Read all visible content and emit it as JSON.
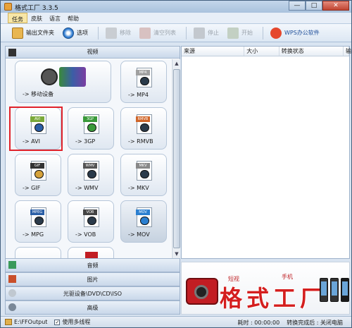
{
  "window": {
    "title": "格式工厂 3.3.5",
    "minimize": "—",
    "maximize": "□",
    "close": "✕"
  },
  "menu": [
    "任务",
    "皮肤",
    "语言",
    "帮助"
  ],
  "toolbar": {
    "output_folder": "输出文件夹",
    "options": "选项",
    "remove": "移除",
    "clear_list": "清空列表",
    "stop": "停止",
    "start": "开始",
    "wps": "WPS办公软件"
  },
  "video_header": "视频",
  "tiles": [
    {
      "label": "-> 移动设备",
      "tag": ""
    },
    {
      "label": "-> MP4",
      "tag": "MP4"
    },
    {
      "label": "-> AVI",
      "tag": "AVI"
    },
    {
      "label": "-> 3GP",
      "tag": "3GP"
    },
    {
      "label": "-> RMVB",
      "tag": "RMVB"
    },
    {
      "label": "-> GIF",
      "tag": "GIF"
    },
    {
      "label": "-> WMV",
      "tag": "WMV"
    },
    {
      "label": "-> MKV",
      "tag": "MKV"
    },
    {
      "label": "-> MPG",
      "tag": "MPEG"
    },
    {
      "label": "-> VOB",
      "tag": "VOB"
    },
    {
      "label": "-> MOV",
      "tag": "MOV"
    }
  ],
  "categories": [
    "音频",
    "图片",
    "光驱设备\\DVD\\CD\\ISO",
    "高级"
  ],
  "file_list": {
    "col_source": "来源",
    "col_size": "大小",
    "col_status": "转换状态",
    "col_out": "输"
  },
  "banner": {
    "brand": "格式工厂",
    "word1": "短视",
    "word2": "手机"
  },
  "status": {
    "output_path": "E:\\FFOutput",
    "multithread": "使用多线程",
    "elapsed_label": "耗时 : 00:00:00",
    "after_convert": "转换完成后 : 关闭电脑"
  }
}
